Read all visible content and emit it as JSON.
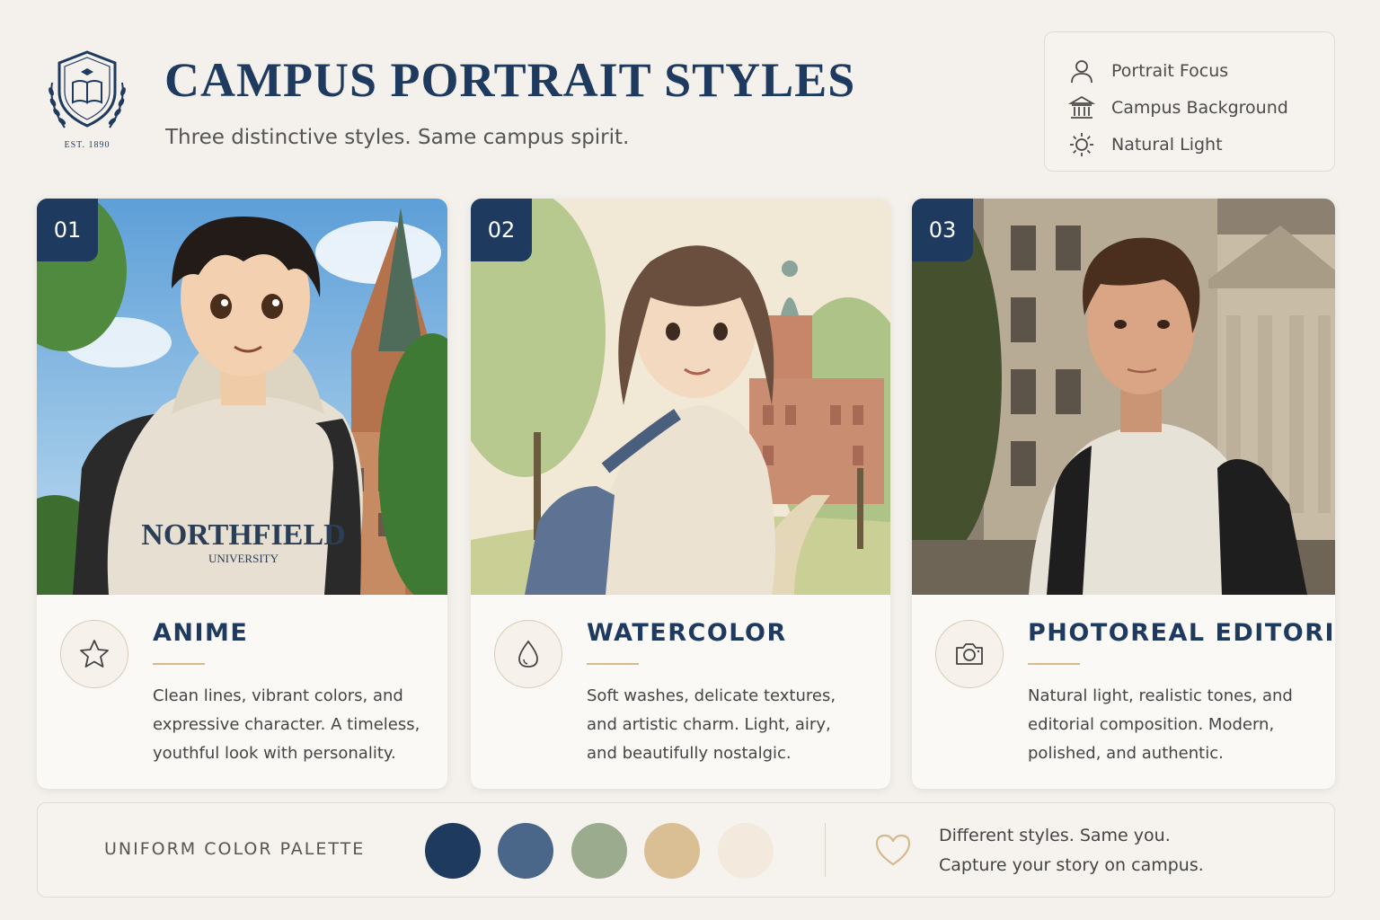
{
  "header": {
    "crest_est": "EST. 1890",
    "title": "CAMPUS PORTRAIT STYLES",
    "subtitle": "Three distinctive styles. Same campus spirit."
  },
  "legend": {
    "items": [
      {
        "icon": "person-icon",
        "label": "Portrait Focus"
      },
      {
        "icon": "building-icon",
        "label": "Campus Background"
      },
      {
        "icon": "sun-icon",
        "label": "Natural Light"
      }
    ]
  },
  "cards": [
    {
      "number": "01",
      "icon": "star-icon",
      "name": "ANIME",
      "description": "Clean lines, vibrant colors, and expressive character. A timeless, youthful look with personality.",
      "hoodie_text": "NORTHFIELD",
      "hoodie_subtext": "UNIVERSITY"
    },
    {
      "number": "02",
      "icon": "droplet-icon",
      "name": "WATERCOLOR",
      "description": "Soft washes, delicate textures, and artistic charm. Light, airy, and beautifully nostalgic."
    },
    {
      "number": "03",
      "icon": "camera-icon",
      "name": "PHOTOREAL EDITORIAL",
      "description": "Natural light, realistic tones, and editorial composition. Modern, polished, and authentic."
    }
  ],
  "palette": {
    "label": "UNIFORM COLOR PALETTE",
    "colors": [
      "#1e3a5f",
      "#4a6689",
      "#9aab8e",
      "#dbbf94",
      "#f3e9dc"
    ]
  },
  "tagline": {
    "line1": "Different styles. Same you.",
    "line2": "Capture your story on campus."
  },
  "colors": {
    "navy": "#1e3a5f",
    "accent_gold": "#d6b98d",
    "background": "#f4f1ec"
  }
}
